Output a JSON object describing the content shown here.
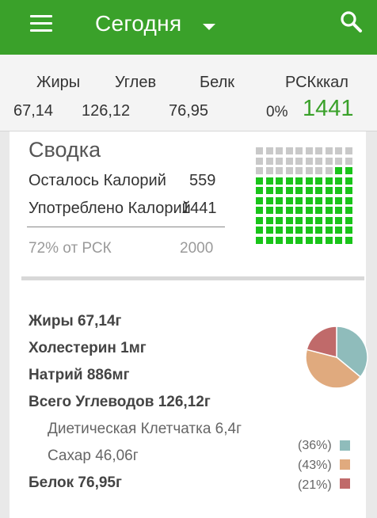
{
  "header": {
    "title": "Сегодня"
  },
  "summary_bar": {
    "labels": {
      "fat": "Жиры",
      "carbs": "Углев",
      "protein": "Белк",
      "rdi_kcal": "РСКккал"
    },
    "values": {
      "fat": "67,14",
      "carbs": "126,12",
      "protein": "76,95",
      "rdi_pct": "0%",
      "calories": "1441"
    }
  },
  "summary": {
    "title": "Сводка",
    "remaining_label": "Осталось Калорий",
    "remaining_value": "559",
    "consumed_label": "Употреблено Калорий",
    "consumed_value": "1441",
    "rdi_pct_label": "72% от РСК",
    "rdi_total": "2000",
    "filled_fraction": 0.72
  },
  "nutrients": {
    "fat": "Жиры 67,14г",
    "cholesterol": "Холестерин 1мг",
    "sodium": "Натрий 886мг",
    "total_carbs": "Всего Углеводов 126,12г",
    "fiber": "Диетическая Клетчатка 6,4г",
    "sugar": "Сахар 46,06г",
    "protein": "Белок 76,95г"
  },
  "chart_data": {
    "type": "pie",
    "values": [
      36,
      43,
      21
    ],
    "labels": [
      "(36%)",
      "(43%)",
      "(21%)"
    ],
    "colors": [
      "#8fbcbb",
      "#e0aa7e",
      "#c06a6a"
    ]
  },
  "colors": {
    "accent": "#3aa12a",
    "grid_filled": "#19c419",
    "grid_empty": "#c9c9c9"
  }
}
